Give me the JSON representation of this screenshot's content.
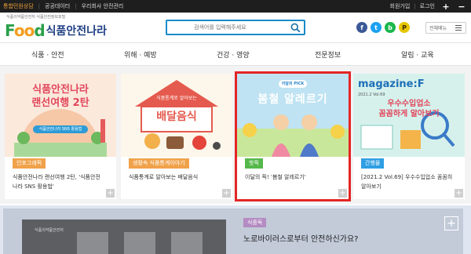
{
  "utility": {
    "links": [
      "통합민원상담",
      "공공데이터",
      "우리회사 안전관리"
    ],
    "right_links": [
      "회원가입",
      "로그인"
    ]
  },
  "header": {
    "logo_word": "Food",
    "logo_name": "식품안전나라",
    "logo_small": "식품의약품안전처 식품안전정보포털",
    "search_placeholder": "검색어를 입력해주세요",
    "allmenu_label": "전체메뉴"
  },
  "nav": {
    "items": [
      "식품 · 안전",
      "위해 · 예방",
      "건강 · 영양",
      "전문정보",
      "알림 · 교육"
    ]
  },
  "cards": [
    {
      "thumb_text": [
        "식품안전나라",
        "랜선여행 2탄"
      ],
      "thumb_sub": "식품안전나라 SNS 활용법",
      "tag": "인포그래픽",
      "tag_color": "#f0a24a",
      "title": "식품안전나라 랜선여행 2탄, '식품안전나라 SNS 활용법'"
    },
    {
      "thumb_text": [
        "식품통계로 알아보는",
        "배달음식"
      ],
      "tag": "생활속 식품통계이야기",
      "tag_color": "#f0a24a",
      "title": "식품통계로 알아보는 배달음식"
    },
    {
      "thumb_badge": "이달의 PICK",
      "thumb_text": [
        "봄철 알레르기"
      ],
      "tag": "핫픽",
      "tag_color": "#56b84b",
      "title": "이달의 픽! '봄철 알레르기'"
    },
    {
      "thumb_text": [
        "magazine:F",
        "우수수입업소",
        "꼼꼼하게 알아보기"
      ],
      "thumb_sub": "2021.2 Vol.69",
      "tag": "간행물",
      "tag_color": "#2f9fe3",
      "title": "[2021.2 Vol.69] 우수수입업소 꼼꼼히 알아보기"
    }
  ],
  "feature": {
    "tag": "식중독",
    "title": "노로바이러스로부터 안전하신가요?",
    "doc_label": "식품의약품안전처"
  },
  "icons": [
    "search-icon",
    "facebook-icon",
    "twitter-icon",
    "naver-icon",
    "kakao-icon",
    "menu-icon",
    "plus-icon",
    "minus-icon"
  ]
}
